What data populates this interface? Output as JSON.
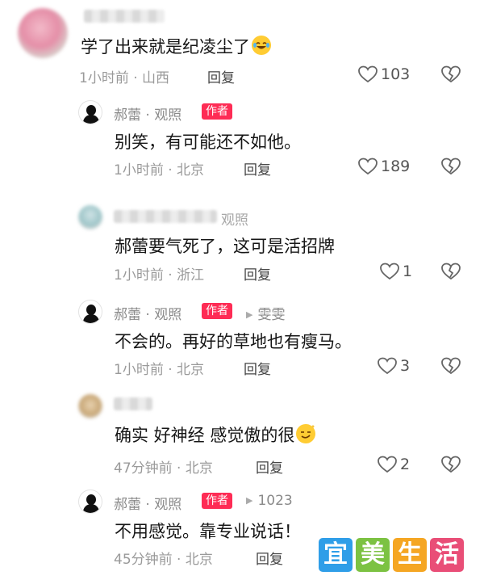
{
  "comments": [
    {
      "text": "学了出来就是纪凌尘了",
      "emoji": "laughing-crying-emoji",
      "meta": "1小时前 · 山西",
      "reply_label": "回复",
      "likes": "103"
    },
    {
      "author": "郝蕾 · 观照",
      "badge": "作者",
      "text": "别笑，有可能还不如他。",
      "meta": "1小时前 · 北京",
      "reply_label": "回复",
      "likes": "189"
    },
    {
      "author_fragment": "观照",
      "text": "郝蕾要气死了，这可是活招牌",
      "meta": "1小时前 · 浙江",
      "reply_label": "回复",
      "likes": "1"
    },
    {
      "author": "郝蕾 · 观照",
      "badge": "作者",
      "reply_to": "雯雯",
      "text": "不会的。再好的草地也有瘦马。",
      "meta": "1小时前 · 北京",
      "reply_label": "回复",
      "likes": "3"
    },
    {
      "text": "确实 好神经 感觉傲的很",
      "emoji": "smug-smile-emoji",
      "meta": "47分钟前 · 北京",
      "reply_label": "回复",
      "likes": "2"
    },
    {
      "author": "郝蕾 · 观照",
      "badge": "作者",
      "reply_to": "1023",
      "text": "不用感觉。靠专业说话！",
      "meta": "45分钟前 · 北京",
      "reply_label": "回复"
    }
  ],
  "watermark": {
    "chars": [
      "宜",
      "美",
      "生",
      "活"
    ],
    "colors": [
      "#2f9ee8",
      "#7cc242",
      "#f5a623",
      "#e94e77"
    ]
  },
  "colors": {
    "author_badge": "#fe2c55"
  }
}
